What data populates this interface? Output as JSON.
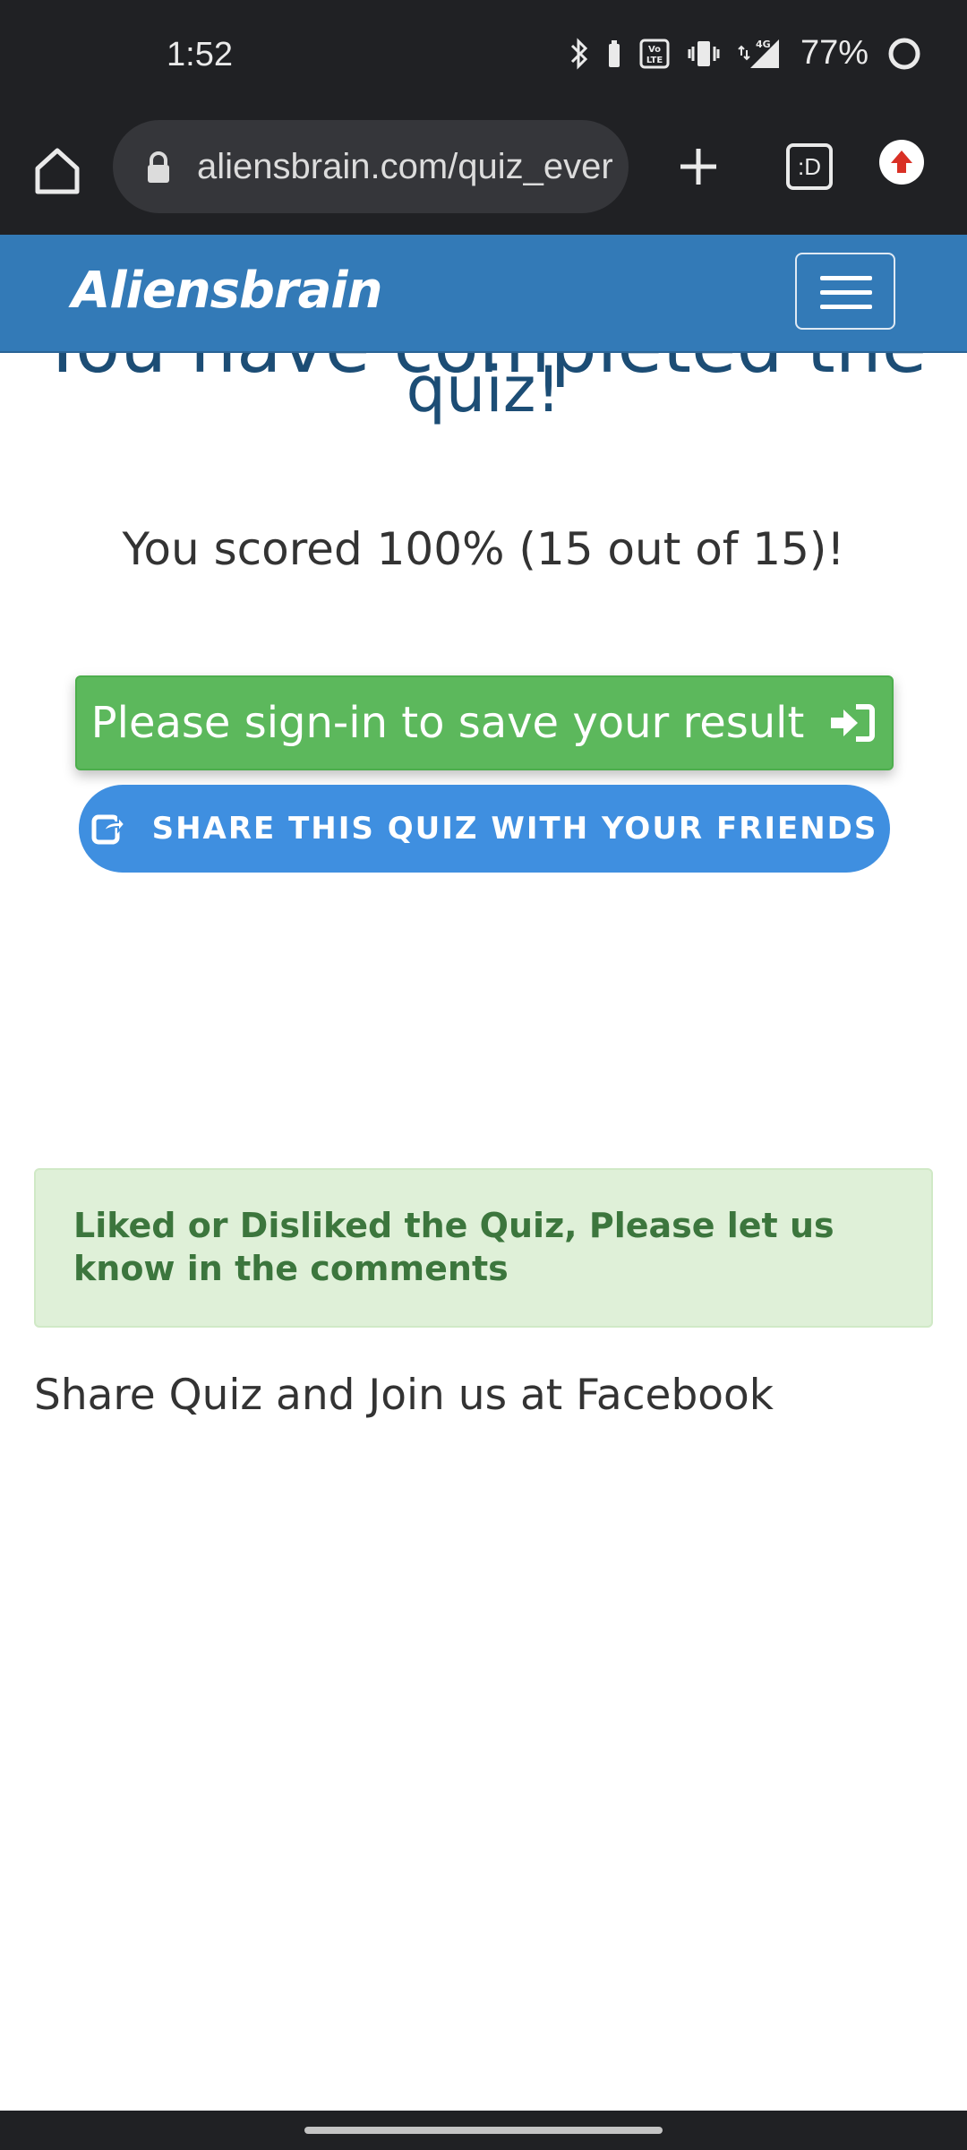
{
  "status_bar": {
    "time": "1:52",
    "battery_percent": "77%",
    "network": "4G"
  },
  "browser": {
    "url": "aliensbrain.com/quiz_ever",
    "tabs_label": ":D"
  },
  "site": {
    "brand": "Aliensbrain"
  },
  "content": {
    "heading_line1": "You have completed the",
    "heading_line2": "quiz!",
    "score": "You scored 100% (15 out of 15)!",
    "signin_label": "Please sign-in to save your result",
    "share_label": "SHARE THIS QUIZ WITH YOUR FRIENDS",
    "alert_message": "Liked or Disliked the Quiz, Please let us know in the comments",
    "share_join": "Share Quiz and Join us at Facebook"
  },
  "colors": {
    "navbar": "#337ab7",
    "signin_green": "#5cb85c",
    "share_blue": "#3f8fe0",
    "alert_bg": "#dff0d8",
    "alert_text": "#3c763d",
    "heading": "#1c4d75"
  },
  "icons": {
    "home": "home-icon",
    "lock": "lock-icon",
    "new_tab": "plus-icon",
    "tabs": "tab-switcher-icon",
    "extension": "upload-arrow-icon",
    "menu": "hamburger-icon",
    "signin": "sign-in-icon",
    "share": "share-icon"
  }
}
